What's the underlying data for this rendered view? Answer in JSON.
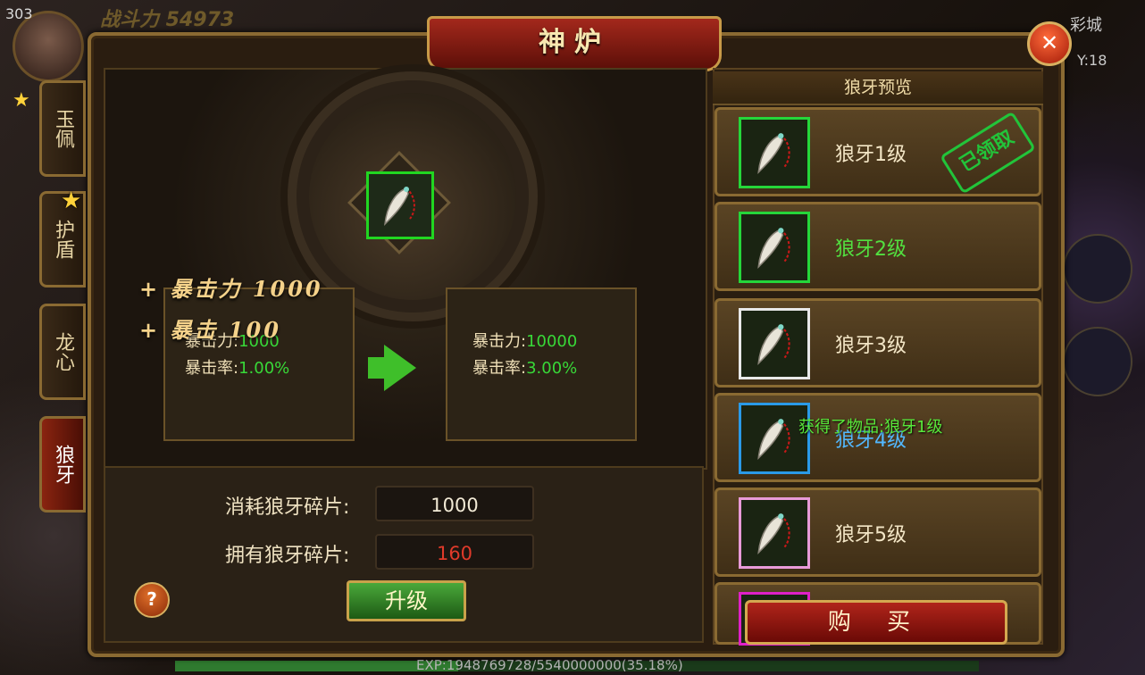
{
  "hud": {
    "level": "303",
    "power": "战斗力 54973",
    "city": "彩城",
    "coord_y": "Y:18",
    "exp": "EXP:1948769728/5540000000(35.18%)",
    "exp_progress": 0.3518,
    "star_icon": "star-icon",
    "avatar_icon": "player-avatar"
  },
  "window": {
    "title": "神炉",
    "close_label": "✕"
  },
  "tabs": [
    {
      "label": "玉佩",
      "active": false
    },
    {
      "label": "护盾",
      "active": false
    },
    {
      "label": "龙心",
      "active": false
    },
    {
      "label": "狼牙",
      "active": true
    }
  ],
  "forge": {
    "item_icon": "wolf-fang-icon",
    "gain": [
      {
        "label": "+ 暴击力 1000"
      },
      {
        "label": "+ 暴击 100"
      }
    ],
    "current": [
      {
        "name": "暴击力:",
        "value": "1000"
      },
      {
        "name": "暴击率:",
        "value": "1.00%"
      }
    ],
    "next": [
      {
        "name": "暴击力:",
        "value": "10000"
      },
      {
        "name": "暴击率:",
        "value": "3.00%"
      }
    ],
    "cost_label": "消耗狼牙碎片:",
    "cost_value": "1000",
    "owned_label": "拥有狼牙碎片:",
    "owned_value": "160",
    "help_label": "?",
    "upgrade_label": "升级"
  },
  "preview": {
    "header": "狼牙预览",
    "items": [
      {
        "label": "狼牙1级",
        "border": "#25d63a",
        "text_color": "#f3e6c6"
      },
      {
        "label": "狼牙2级",
        "border": "#25d63a",
        "text_color": "#52e040"
      },
      {
        "label": "狼牙3级",
        "border": "#e8e8e8",
        "text_color": "#f3e6c6"
      },
      {
        "label": "狼牙4级",
        "border": "#2a9ae8",
        "text_color": "#52b8ff"
      },
      {
        "label": "狼牙5级",
        "border": "#e89ad8",
        "text_color": "#f3e6c6"
      }
    ],
    "claimed_stamp": "已领取",
    "toast": "获得了物品:狼牙1级",
    "buy_label": "购 买"
  }
}
